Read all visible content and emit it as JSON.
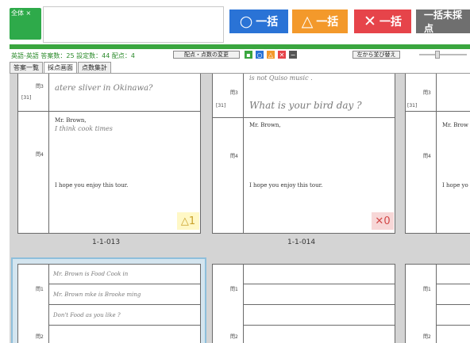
{
  "header": {
    "tag_label": "全体 ×",
    "bulk_circle": {
      "symbol": "○",
      "label": "一括"
    },
    "bulk_triangle": {
      "symbol": "△",
      "label": "一括"
    },
    "bulk_x": {
      "symbol": "✕",
      "label": "一括"
    },
    "bulk_unmarked": "一括未採点"
  },
  "infobar": {
    "stats": "英語-英語  答案数：25  設定数：44  配点：4",
    "change_score_button": "配点・点数の変更",
    "sort_button": "左から並び替え"
  },
  "tabs": [
    "答案一覧",
    "採点画面",
    "点数集計"
  ],
  "cards": {
    "c1": {
      "id": "1-1-013",
      "q_num": "[31]",
      "hw_top": "atere sliver in Okinawa?",
      "print_name": "Mr. Brown,",
      "hw_name": "I think cook times",
      "print_footer": "I hope you enjoy this tour.",
      "score_symbol": "△",
      "score_value": "1"
    },
    "c2": {
      "id": "1-1-014",
      "q_num": "[31]",
      "hw_partial": "is not    Quiso music .",
      "hw_top": "What is your bird day ?",
      "print_name": "Mr. Brown,",
      "print_footer": "I hope you enjoy this tour.",
      "score_symbol": "✕",
      "score_value": "0"
    },
    "c3": {
      "q_num": "[31]",
      "print_name": "Mr. Brow",
      "print_footer": "I hope yo"
    },
    "c4": {
      "hw_1": "Mr. Brown   is   Food   Cook in",
      "hw_2": "Mr. Brown   mke  is  Brooke  ming",
      "hw_3": "Don't Food   as   you   like ?"
    }
  }
}
